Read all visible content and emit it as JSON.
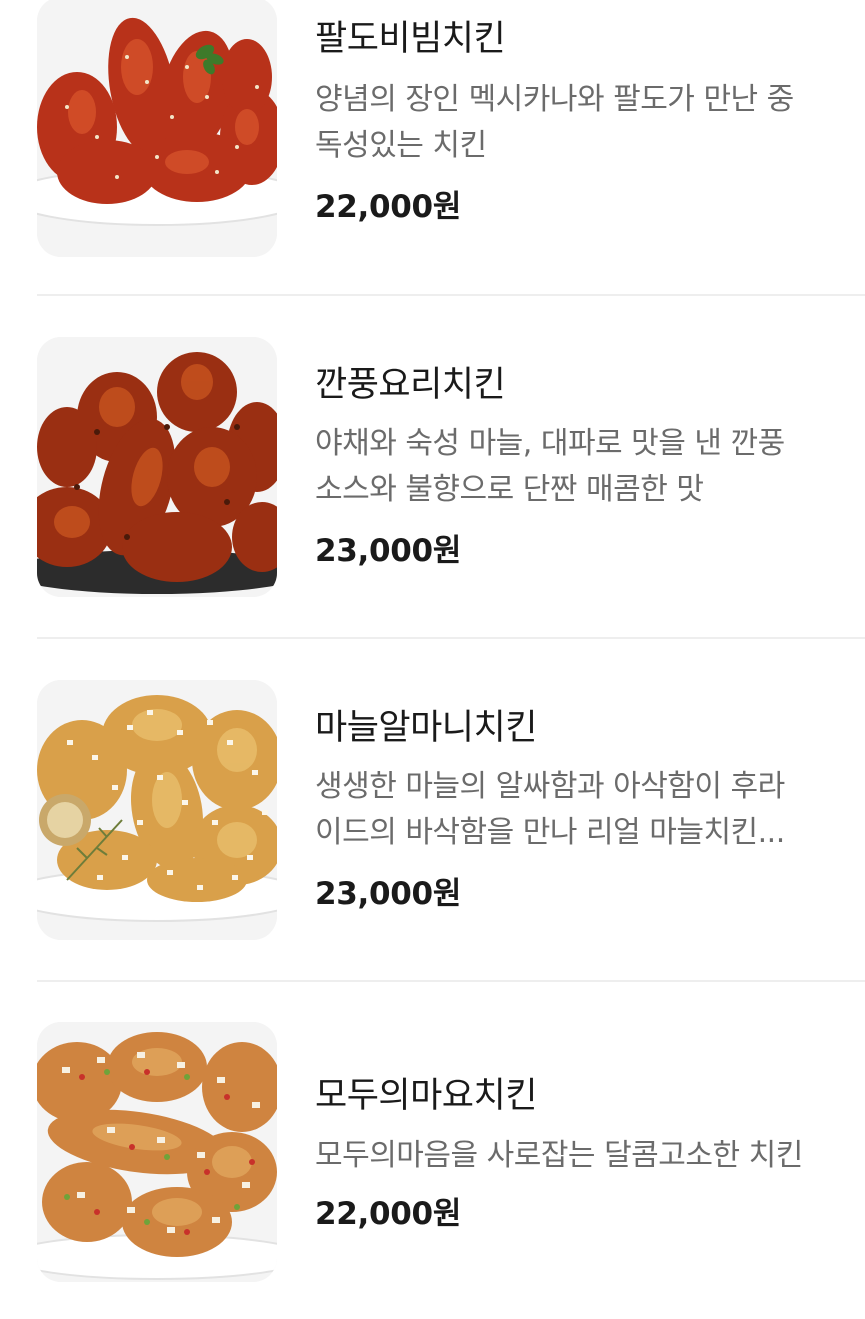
{
  "menu_items": [
    {
      "name": "팔도비빔치킨",
      "description_lines": [
        "양념의 장인 멕시카나와 팔도가 만난 중",
        "독성있는 치킨"
      ],
      "price": "22,000원",
      "image": "spicy-glazed-chicken-on-white-plate"
    },
    {
      "name": "깐풍요리치킨",
      "description_lines": [
        "야채와 숙성 마늘, 대파로 맛을 낸 깐풍",
        "소스와 불향으로 단짠 매콤한 맛"
      ],
      "price": "23,000원",
      "image": "kkanpung-glazed-chicken-on-dark-plate"
    },
    {
      "name": "마늘알마니치킨",
      "description_lines": [
        "생생한 마늘의 알싸함과 아삭함이 후라",
        "이드의 바삭함을 만나 리얼 마늘치킨..."
      ],
      "price": "23,000원",
      "image": "garlic-fried-chicken-on-white-plate"
    },
    {
      "name": "모두의마요치킨",
      "description_lines": [
        "모두의마음을 사로잡는 달콤고소한 치킨"
      ],
      "price": "22,000원",
      "image": "mayo-chicken-with-onion-topping"
    }
  ],
  "colors": {
    "text_primary": "#1a1a1a",
    "text_secondary": "#6b6b6b",
    "divider": "#eeeeee",
    "thumb_background": "#f3f3f3"
  }
}
